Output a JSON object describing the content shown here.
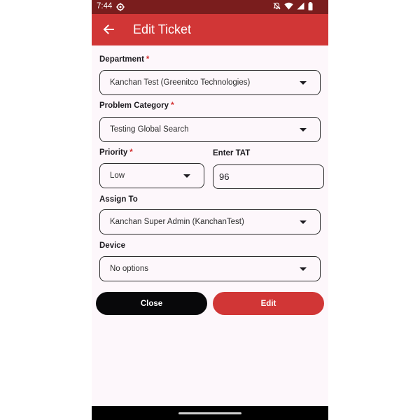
{
  "status": {
    "time": "7:44"
  },
  "appbar": {
    "title": "Edit Ticket"
  },
  "form": {
    "required_mark": "*",
    "department": {
      "label": "Department",
      "value": "Kanchan Test (Greenitco Technologies)"
    },
    "problem_category": {
      "label": "Problem Category",
      "value": "Testing Global Search"
    },
    "priority": {
      "label": "Priority",
      "value": "Low"
    },
    "tat": {
      "label": "Enter TAT",
      "value": "96"
    },
    "assign_to": {
      "label": "Assign To",
      "value": "Kanchan Super Admin (KanchanTest)"
    },
    "device": {
      "label": "Device",
      "value": "No options"
    }
  },
  "actions": {
    "close_label": "Close",
    "edit_label": "Edit"
  },
  "colors": {
    "appbar": "#d13636",
    "statusbar": "#7a1d1d",
    "close_button": "#08080a",
    "edit_button": "#d13636",
    "required": "#d32f2f"
  },
  "icons": {
    "back": "arrow-left-icon",
    "settings": "gear-icon",
    "mute": "bell-off-icon",
    "wifi": "wifi-icon",
    "signal": "signal-icon",
    "battery": "battery-icon",
    "dropdown": "caret-down-icon"
  }
}
